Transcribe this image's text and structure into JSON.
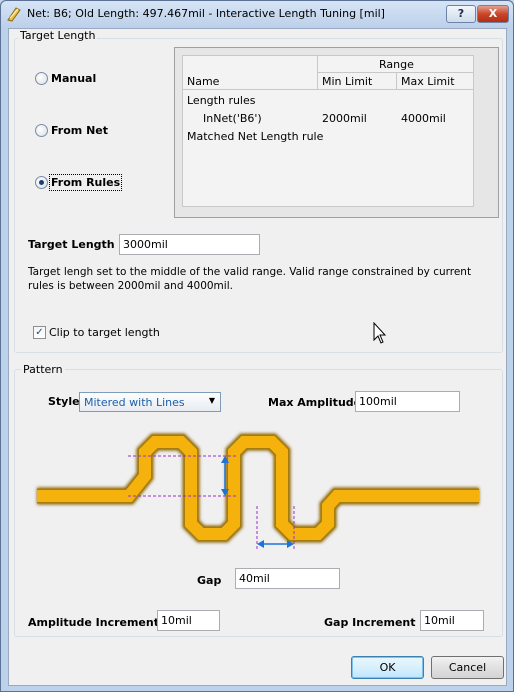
{
  "window": {
    "title": "Net: B6;  Old Length: 497.467mil -  Interactive Length Tuning [mil]",
    "help_label": "?",
    "close_label": "X"
  },
  "target_length": {
    "group_label": "Target Length",
    "options": [
      {
        "label": "Manual",
        "checked": false
      },
      {
        "label": "From Net",
        "checked": false
      },
      {
        "label": "From Rules",
        "checked": true
      }
    ],
    "rules_table": {
      "range_header": "Range",
      "columns": [
        "Name",
        "Min Limit",
        "Max Limit"
      ],
      "rows": [
        {
          "name": "Length rules",
          "min": "",
          "max": ""
        },
        {
          "name": "InNet('B6')",
          "min": "2000mil",
          "max": "4000mil"
        },
        {
          "name": "Matched Net Length rule",
          "min": "",
          "max": ""
        }
      ]
    },
    "target_length_label": "Target Length",
    "target_length_value": "3000mil",
    "info_text": "Target lengh set to the middle of the valid range. Valid range constrained by current rules is between 2000mil and 4000mil.",
    "clip_label": "Clip to target length",
    "clip_checked": true
  },
  "pattern": {
    "group_label": "Pattern",
    "style_label": "Style",
    "style_value": "Mitered with Lines",
    "max_amplitude_label": "Max Amplitude",
    "max_amplitude_value": "100mil",
    "gap_label": "Gap",
    "gap_value": "40mil",
    "amplitude_increment_label": "Amplitude Increment",
    "amplitude_increment_value": "10mil",
    "gap_increment_label": "Gap Increment",
    "gap_increment_value": "10mil"
  },
  "buttons": {
    "ok": "OK",
    "cancel": "Cancel"
  },
  "colors": {
    "trace": "#f4b20a",
    "trace_edge": "#8a6400",
    "dimension": "#1e73d8",
    "guide": "#9b30d0"
  }
}
